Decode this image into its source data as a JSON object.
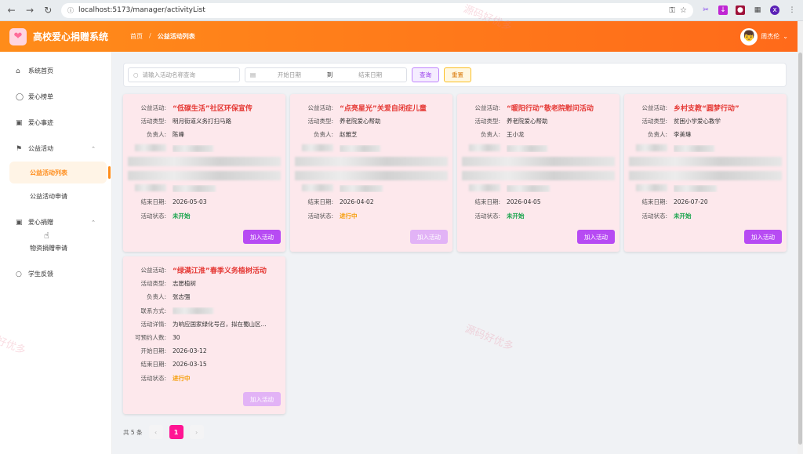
{
  "browser": {
    "url": "localhost:5173/manager/activityList"
  },
  "header": {
    "title": "高校爱心捐赠系统",
    "crumb_home": "首页",
    "crumb_current": "公益活动列表",
    "user_name": "周杰伦"
  },
  "sidebar": {
    "home": "系统首页",
    "ranking": "爱心榜单",
    "stories": "爱心事迹",
    "activity": "公益活动",
    "activity_list": "公益活动列表",
    "activity_apply": "公益活动申请",
    "donation": "爱心捐赠",
    "goods_apply": "物资捐赠申请",
    "feedback": "学生反馈"
  },
  "search": {
    "placeholder": "请输入活动名称查询",
    "start_placeholder": "开始日期",
    "to": "到",
    "end_placeholder": "结束日期",
    "query": "查询",
    "reset": "重置"
  },
  "labels": {
    "name": "公益活动:",
    "type": "活动类型:",
    "leader": "负责人:",
    "contact": "联系方式:",
    "detail": "活动详情:",
    "capacity": "可预约人数:",
    "start": "开始日期:",
    "end": "结束日期:",
    "status": "活动状态:",
    "join": "加入活动"
  },
  "cards": [
    {
      "name": "“低碳生活”社区环保宣传",
      "type": "明月街道义务打扫马路",
      "leader": "陈峰",
      "end": "2026-05-03",
      "status": "未开始"
    },
    {
      "name": "“点亮星光”关爱自闭症儿童",
      "type": "养老院爱心帮助",
      "leader": "赵雅芝",
      "end": "2026-04-02",
      "status": "进行中"
    },
    {
      "name": "“暖阳行动”敬老院慰问活动",
      "type": "养老院爱心帮助",
      "leader": "王小龙",
      "end": "2026-04-05",
      "status": "未开始"
    },
    {
      "name": "乡村支教“圆梦行动”",
      "type": "贫困小学爱心教学",
      "leader": "李美琳",
      "end": "2026-07-20",
      "status": "未开始"
    },
    {
      "name": "“绿满江淮”春季义务植树活动",
      "type": "志愿植树",
      "leader": "张志强",
      "detail": "为响应国家绿化号召，拟在蜀山区...",
      "capacity": "30",
      "start": "2026-03-12",
      "end": "2026-03-15",
      "status": "进行中"
    }
  ],
  "pager": {
    "total": "共 5 条",
    "current": "1"
  },
  "watermark": "源码好优多"
}
